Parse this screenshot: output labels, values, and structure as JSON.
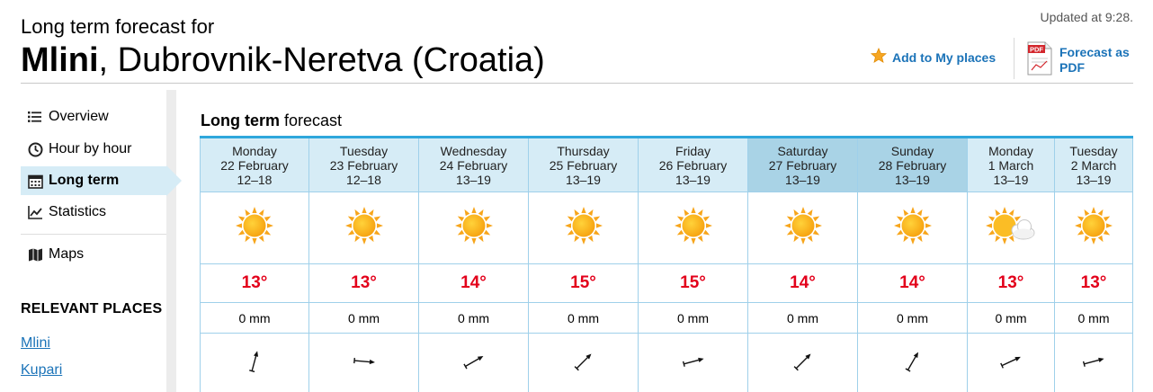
{
  "header": {
    "subtitle": "Long term forecast for",
    "place_bold": "Mlini",
    "place_rest": ", Dubrovnik-Neretva (Croatia)",
    "updated": "Updated at 9:28.",
    "add_to_places": "Add to My places",
    "pdf_label": "Forecast as PDF",
    "pdf_badge": "PDF"
  },
  "sidebar": {
    "items": [
      {
        "label": "Overview",
        "icon": "list-icon",
        "active": false
      },
      {
        "label": "Hour by hour",
        "icon": "clock-icon",
        "active": false
      },
      {
        "label": "Long term",
        "icon": "calendar-icon",
        "active": true
      },
      {
        "label": "Statistics",
        "icon": "chart-icon",
        "active": false
      },
      {
        "label": "Maps",
        "icon": "map-icon",
        "active": false
      }
    ],
    "relevant_heading": "RELEVANT PLACES",
    "relevant_places": [
      "Mlini",
      "Kupari"
    ]
  },
  "forecast": {
    "title_bold": "Long term",
    "title_rest": " forecast",
    "days": [
      {
        "weekday": "Monday",
        "date": "22 February",
        "period": "12–18",
        "icon": "sun-icon",
        "temp": "13°",
        "precip": "0 mm",
        "weekend": false
      },
      {
        "weekday": "Tuesday",
        "date": "23 February",
        "period": "12–18",
        "icon": "sun-icon",
        "temp": "13°",
        "precip": "0 mm",
        "weekend": false
      },
      {
        "weekday": "Wednesday",
        "date": "24 February",
        "period": "13–19",
        "icon": "sun-icon",
        "temp": "14°",
        "precip": "0 mm",
        "weekend": false
      },
      {
        "weekday": "Thursday",
        "date": "25 February",
        "period": "13–19",
        "icon": "sun-icon",
        "temp": "15°",
        "precip": "0 mm",
        "weekend": false
      },
      {
        "weekday": "Friday",
        "date": "26 February",
        "period": "13–19",
        "icon": "sun-icon",
        "temp": "15°",
        "precip": "0 mm",
        "weekend": false
      },
      {
        "weekday": "Saturday",
        "date": "27 February",
        "period": "13–19",
        "icon": "sun-icon",
        "temp": "14°",
        "precip": "0 mm",
        "weekend": true
      },
      {
        "weekday": "Sunday",
        "date": "28 February",
        "period": "13–19",
        "icon": "sun-icon",
        "temp": "14°",
        "precip": "0 mm",
        "weekend": true
      },
      {
        "weekday": "Monday",
        "date": "1 March",
        "period": "13–19",
        "icon": "sun-cloud-icon",
        "temp": "13°",
        "precip": "0 mm",
        "weekend": false
      },
      {
        "weekday": "Tuesday",
        "date": "2 March",
        "period": "13–19",
        "icon": "sun-icon",
        "temp": "13°",
        "precip": "0 mm",
        "weekend": false
      }
    ]
  },
  "colors": {
    "accent": "#2fa7dc",
    "link": "#1b73b8",
    "temperature": "#e3001b",
    "header_cell": "#d6ecf6",
    "weekend_cell": "#a9d3e6"
  }
}
